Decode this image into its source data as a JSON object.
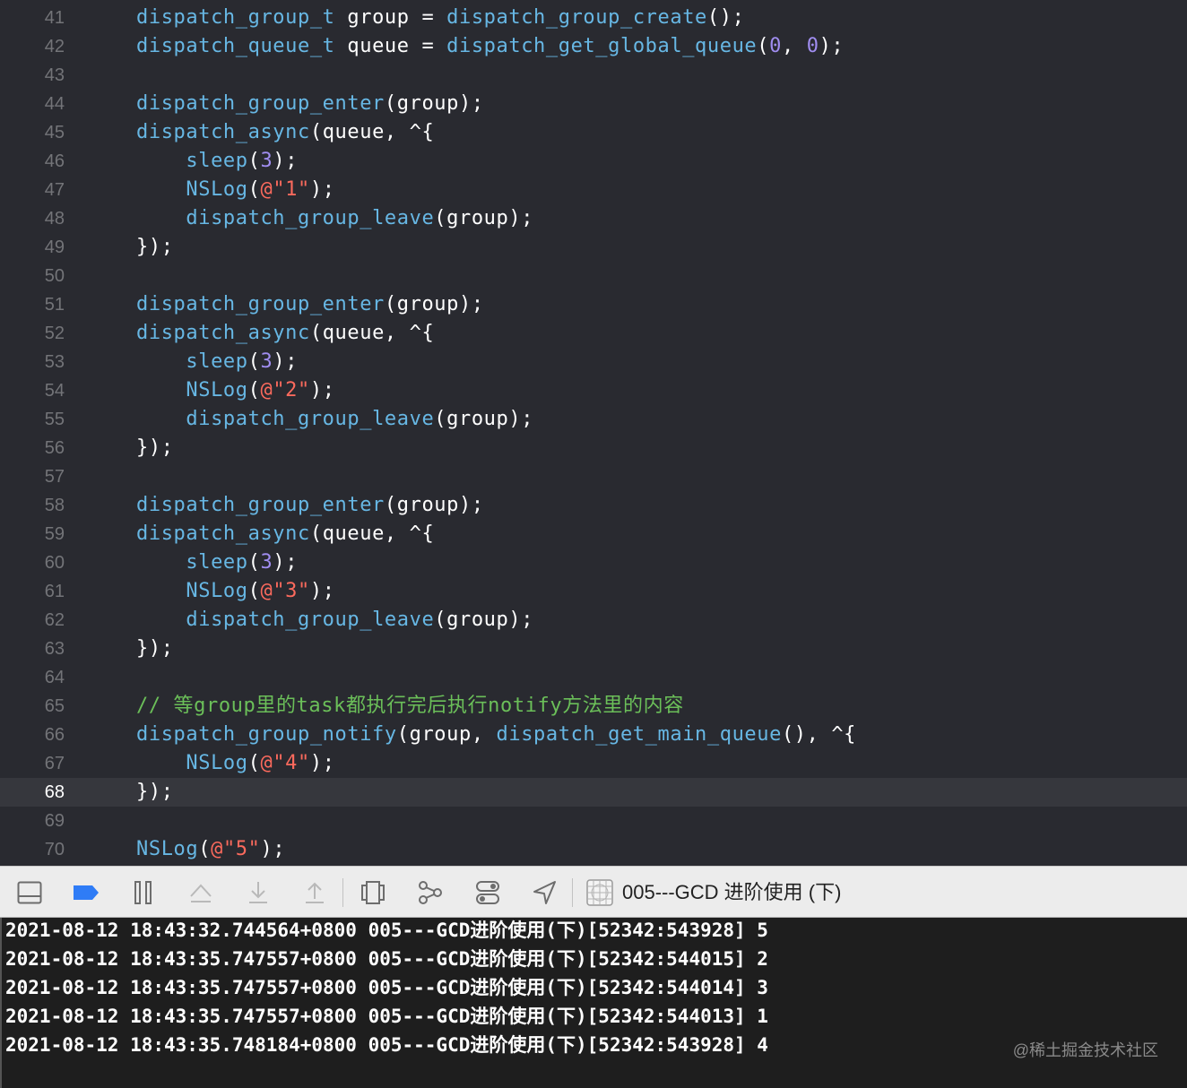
{
  "editor": {
    "current_line": "68",
    "lines": [
      {
        "n": "41",
        "seg": [
          [
            "fn",
            "dispatch_group_t"
          ],
          [
            "p",
            " group = "
          ],
          [
            "fn",
            "dispatch_group_create"
          ],
          [
            "p",
            "();"
          ]
        ]
      },
      {
        "n": "42",
        "seg": [
          [
            "fn",
            "dispatch_queue_t"
          ],
          [
            "p",
            " queue = "
          ],
          [
            "fn",
            "dispatch_get_global_queue"
          ],
          [
            "p",
            "("
          ],
          [
            "num",
            "0"
          ],
          [
            "p",
            ", "
          ],
          [
            "num",
            "0"
          ],
          [
            "p",
            ");"
          ]
        ]
      },
      {
        "n": "43",
        "seg": []
      },
      {
        "n": "44",
        "seg": [
          [
            "fn",
            "dispatch_group_enter"
          ],
          [
            "p",
            "(group);"
          ]
        ]
      },
      {
        "n": "45",
        "seg": [
          [
            "fn",
            "dispatch_async"
          ],
          [
            "p",
            "(queue, ^{"
          ]
        ]
      },
      {
        "n": "46",
        "seg": [
          [
            "p",
            "    "
          ],
          [
            "fn",
            "sleep"
          ],
          [
            "p",
            "("
          ],
          [
            "num",
            "3"
          ],
          [
            "p",
            ");"
          ]
        ]
      },
      {
        "n": "47",
        "seg": [
          [
            "p",
            "    "
          ],
          [
            "fn",
            "NSLog"
          ],
          [
            "p",
            "("
          ],
          [
            "str",
            "@\"1\""
          ],
          [
            "p",
            ");"
          ]
        ]
      },
      {
        "n": "48",
        "seg": [
          [
            "p",
            "    "
          ],
          [
            "fn",
            "dispatch_group_leave"
          ],
          [
            "p",
            "(group);"
          ]
        ]
      },
      {
        "n": "49",
        "seg": [
          [
            "p",
            "});"
          ]
        ]
      },
      {
        "n": "50",
        "seg": []
      },
      {
        "n": "51",
        "seg": [
          [
            "fn",
            "dispatch_group_enter"
          ],
          [
            "p",
            "(group);"
          ]
        ]
      },
      {
        "n": "52",
        "seg": [
          [
            "fn",
            "dispatch_async"
          ],
          [
            "p",
            "(queue, ^{"
          ]
        ]
      },
      {
        "n": "53",
        "seg": [
          [
            "p",
            "    "
          ],
          [
            "fn",
            "sleep"
          ],
          [
            "p",
            "("
          ],
          [
            "num",
            "3"
          ],
          [
            "p",
            ");"
          ]
        ]
      },
      {
        "n": "54",
        "seg": [
          [
            "p",
            "    "
          ],
          [
            "fn",
            "NSLog"
          ],
          [
            "p",
            "("
          ],
          [
            "str",
            "@\"2\""
          ],
          [
            "p",
            ");"
          ]
        ]
      },
      {
        "n": "55",
        "seg": [
          [
            "p",
            "    "
          ],
          [
            "fn",
            "dispatch_group_leave"
          ],
          [
            "p",
            "(group);"
          ]
        ]
      },
      {
        "n": "56",
        "seg": [
          [
            "p",
            "});"
          ]
        ]
      },
      {
        "n": "57",
        "seg": []
      },
      {
        "n": "58",
        "seg": [
          [
            "fn",
            "dispatch_group_enter"
          ],
          [
            "p",
            "(group);"
          ]
        ]
      },
      {
        "n": "59",
        "seg": [
          [
            "fn",
            "dispatch_async"
          ],
          [
            "p",
            "(queue, ^{"
          ]
        ]
      },
      {
        "n": "60",
        "seg": [
          [
            "p",
            "    "
          ],
          [
            "fn",
            "sleep"
          ],
          [
            "p",
            "("
          ],
          [
            "num",
            "3"
          ],
          [
            "p",
            ");"
          ]
        ]
      },
      {
        "n": "61",
        "seg": [
          [
            "p",
            "    "
          ],
          [
            "fn",
            "NSLog"
          ],
          [
            "p",
            "("
          ],
          [
            "str",
            "@\"3\""
          ],
          [
            "p",
            ");"
          ]
        ]
      },
      {
        "n": "62",
        "seg": [
          [
            "p",
            "    "
          ],
          [
            "fn",
            "dispatch_group_leave"
          ],
          [
            "p",
            "(group);"
          ]
        ]
      },
      {
        "n": "63",
        "seg": [
          [
            "p",
            "});"
          ]
        ]
      },
      {
        "n": "64",
        "seg": []
      },
      {
        "n": "65",
        "seg": [
          [
            "cmt",
            "// 等group里的task都执行完后执行notify方法里的内容"
          ]
        ]
      },
      {
        "n": "66",
        "seg": [
          [
            "fn",
            "dispatch_group_notify"
          ],
          [
            "p",
            "(group, "
          ],
          [
            "fn",
            "dispatch_get_main_queue"
          ],
          [
            "p",
            "(), ^{"
          ]
        ]
      },
      {
        "n": "67",
        "seg": [
          [
            "p",
            "    "
          ],
          [
            "fn",
            "NSLog"
          ],
          [
            "p",
            "("
          ],
          [
            "str",
            "@\"4\""
          ],
          [
            "p",
            ");"
          ]
        ]
      },
      {
        "n": "68",
        "seg": [
          [
            "p",
            "});"
          ]
        ]
      },
      {
        "n": "69",
        "seg": []
      },
      {
        "n": "70",
        "seg": [
          [
            "fn",
            "NSLog"
          ],
          [
            "p",
            "("
          ],
          [
            "str",
            "@\"5\""
          ],
          [
            "p",
            ");"
          ]
        ]
      }
    ]
  },
  "toolbar": {
    "target_name": "005---GCD 进阶使用 (下)",
    "icons": [
      "hide-debug-area-icon",
      "breakpoints-toggle-icon",
      "pause-icon",
      "step-over-icon",
      "step-into-icon",
      "step-out-icon",
      "view-hierarchy-icon",
      "memory-graph-icon",
      "environment-overrides-icon",
      "simulate-location-icon"
    ],
    "accent_color": "#2f7cf6"
  },
  "console": {
    "lines": [
      "2021-08-12 18:43:32.744564+0800 005---GCD进阶使用(下)[52342:543928] 5",
      "2021-08-12 18:43:35.747557+0800 005---GCD进阶使用(下)[52342:544015] 2",
      "2021-08-12 18:43:35.747557+0800 005---GCD进阶使用(下)[52342:544014] 3",
      "2021-08-12 18:43:35.747557+0800 005---GCD进阶使用(下)[52342:544013] 1",
      "2021-08-12 18:43:35.748184+0800 005---GCD进阶使用(下)[52342:543928] 4"
    ]
  },
  "watermark": "@稀土掘金技术社区"
}
